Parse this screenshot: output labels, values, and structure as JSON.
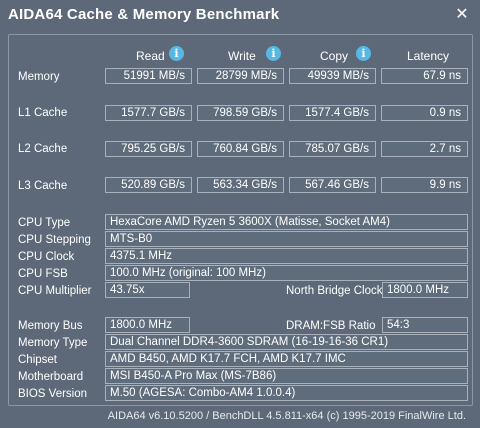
{
  "window": {
    "title": "AIDA64 Cache & Memory Benchmark",
    "close_glyph": "✕"
  },
  "columns": {
    "read": "Read",
    "write": "Write",
    "copy": "Copy",
    "latency": "Latency"
  },
  "icons": {
    "info_glyph": "i",
    "info_color": "#58b8e3"
  },
  "rows": [
    {
      "label": "Memory",
      "read": "51991 MB/s",
      "write": "28799 MB/s",
      "copy": "49939 MB/s",
      "latency": "67.9 ns"
    },
    {
      "label": "L1 Cache",
      "read": "1577.7 GB/s",
      "write": "798.59 GB/s",
      "copy": "1577.4 GB/s",
      "latency": "0.9 ns"
    },
    {
      "label": "L2 Cache",
      "read": "795.25 GB/s",
      "write": "760.84 GB/s",
      "copy": "785.07 GB/s",
      "latency": "2.7 ns"
    },
    {
      "label": "L3 Cache",
      "read": "520.89 GB/s",
      "write": "563.34 GB/s",
      "copy": "567.46 GB/s",
      "latency": "9.9 ns"
    }
  ],
  "cpu": {
    "type_label": "CPU Type",
    "type": "HexaCore AMD Ryzen 5 3600X  (Matisse, Socket AM4)",
    "stepping_label": "CPU Stepping",
    "stepping": "MTS-B0",
    "clock_label": "CPU Clock",
    "clock": "4375.1 MHz",
    "fsb_label": "CPU FSB",
    "fsb": "100.0 MHz  (original: 100 MHz)",
    "multiplier_label": "CPU Multiplier",
    "multiplier": "43.75x",
    "nb_clock_label": "North Bridge Clock",
    "nb_clock": "1800.0 MHz"
  },
  "memory": {
    "bus_label": "Memory Bus",
    "bus": "1800.0 MHz",
    "ratio_label": "DRAM:FSB Ratio",
    "ratio": "54:3",
    "type_label": "Memory Type",
    "type": "Dual Channel DDR4-3600 SDRAM  (16-19-16-36 CR1)",
    "chipset_label": "Chipset",
    "chipset": "AMD B450, AMD K17.7 FCH, AMD K17.7 IMC",
    "motherboard_label": "Motherboard",
    "motherboard": "MSI B450-A Pro Max (MS-7B86)",
    "bios_label": "BIOS Version",
    "bios": "M.50  (AGESA: Combo-AM4 1.0.0.4)"
  },
  "footer": "AIDA64 v6.10.5200 / BenchDLL 4.5.811-x64  (c) 1995-2019 FinalWire Ltd."
}
